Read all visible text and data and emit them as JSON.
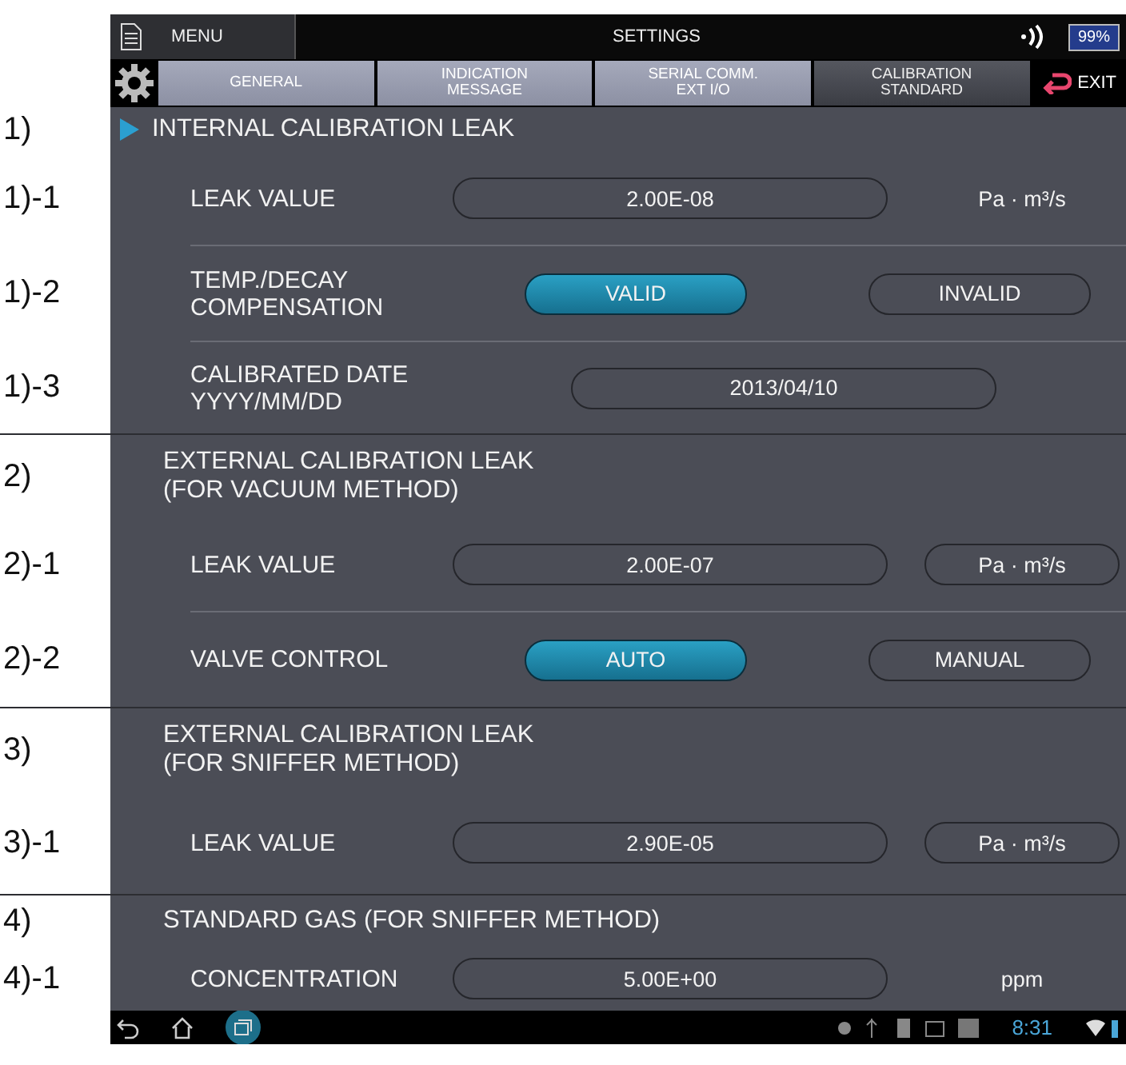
{
  "top_bar": {
    "menu": "MENU",
    "title": "SETTINGS",
    "battery": "99%"
  },
  "tabs": [
    {
      "label": "GENERAL",
      "selected": false
    },
    {
      "label": "INDICATION\nMESSAGE",
      "selected": false
    },
    {
      "label": "SERIAL COMM.\nEXT I/O",
      "selected": false
    },
    {
      "label": "CALIBRATION\nSTANDARD",
      "selected": true
    }
  ],
  "exit": "EXIT",
  "sections": [
    {
      "marker": "1)",
      "title": "INTERNAL CALIBRATION LEAK",
      "current": true,
      "rows": [
        {
          "kind": "value",
          "marker": "1)-1",
          "label": "LEAK VALUE",
          "value": "2.00E-08",
          "unit": "Pa · m³/s",
          "unit_selectable": false
        },
        {
          "kind": "choice",
          "marker": "1)-2",
          "label": "TEMP./DECAY\nCOMPENSATION",
          "options": [
            {
              "label": "VALID",
              "selected": true
            },
            {
              "label": "INVALID",
              "selected": false
            }
          ]
        },
        {
          "kind": "date",
          "marker": "1)-3",
          "label": "CALIBRATED DATE\nYYYY/MM/DD",
          "value": "2013/04/10"
        }
      ]
    },
    {
      "marker": "2)",
      "title": "EXTERNAL CALIBRATION LEAK\n(FOR VACUUM METHOD)",
      "current": false,
      "rows": [
        {
          "kind": "value",
          "marker": "2)-1",
          "label": "LEAK VALUE",
          "value": "2.00E-07",
          "unit": "Pa · m³/s",
          "unit_selectable": true
        },
        {
          "kind": "choice",
          "marker": "2)-2",
          "label": "VALVE CONTROL",
          "options": [
            {
              "label": "AUTO",
              "selected": true
            },
            {
              "label": "MANUAL",
              "selected": false
            }
          ]
        }
      ]
    },
    {
      "marker": "3)",
      "title": "EXTERNAL CALIBRATION LEAK\n(FOR SNIFFER METHOD)",
      "current": false,
      "rows": [
        {
          "kind": "value",
          "marker": "3)-1",
          "label": "LEAK VALUE",
          "value": "2.90E-05",
          "unit": "Pa · m³/s",
          "unit_selectable": true
        }
      ]
    },
    {
      "marker": "4)",
      "title": "STANDARD GAS (FOR SNIFFER METHOD)",
      "current": false,
      "rows": [
        {
          "kind": "value",
          "marker": "4)-1",
          "label": "CONCENTRATION",
          "value": "5.00E+00",
          "unit": "ppm",
          "unit_selectable": false
        }
      ]
    }
  ],
  "nav_bar": {
    "time": "8:31"
  }
}
